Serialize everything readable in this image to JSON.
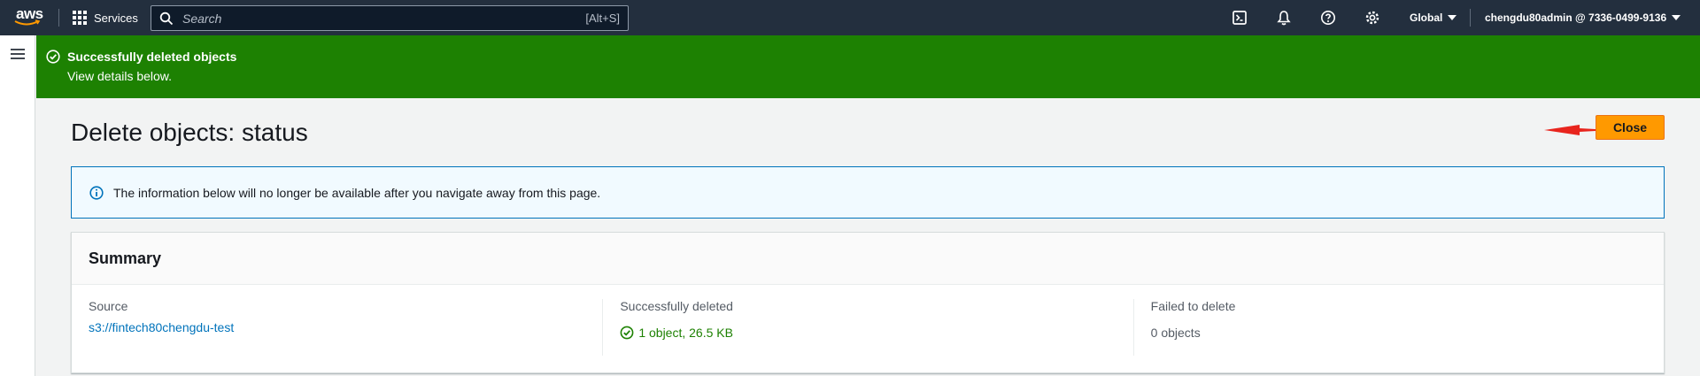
{
  "nav": {
    "logo": "aws",
    "services_label": "Services",
    "search_placeholder": "Search",
    "search_shortcut": "[Alt+S]",
    "region_label": "Global",
    "account_label": "chengdu80admin @ 7336-0499-9136",
    "icons": [
      "cloudshell-icon",
      "bell-icon",
      "help-icon",
      "gear-icon"
    ]
  },
  "flash": {
    "title": "Successfully deleted objects",
    "subtitle": "View details below.",
    "color": "#1d8102"
  },
  "page": {
    "title": "Delete objects: status",
    "close_label": "Close",
    "accent": "#ff9900"
  },
  "info": {
    "text": "The information below will no longer be available after you navigate away from this page."
  },
  "summary": {
    "title": "Summary",
    "source_label": "Source",
    "source_value": "s3://fintech80chengdu-test",
    "deleted_label": "Successfully deleted",
    "deleted_value": "1 object, 26.5 KB",
    "failed_label": "Failed to delete",
    "failed_value": "0 objects"
  }
}
